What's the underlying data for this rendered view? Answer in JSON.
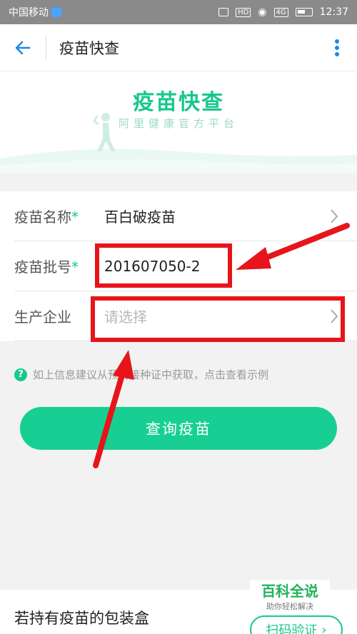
{
  "status_bar": {
    "carrier": "中国移动",
    "network": "4G",
    "hd": "HD",
    "time": "12:37"
  },
  "app_bar": {
    "title": "疫苗快查",
    "back_icon": "back-arrow-icon",
    "more_icon": "more-vertical-icon",
    "accent_color": "#1e88e5"
  },
  "hero": {
    "title": "疫苗快查",
    "subtitle": "阿里健康官方平台",
    "brand_color": "#16c88a"
  },
  "form": {
    "rows": [
      {
        "label": "疫苗名称",
        "required_mark": "*",
        "value": "百白破疫苗",
        "placeholder": ""
      },
      {
        "label": "疫苗批号",
        "required_mark": "*",
        "value": "201607050-2",
        "placeholder": ""
      },
      {
        "label": "生产企业",
        "required_mark": "",
        "value": "",
        "placeholder": "请选择"
      }
    ]
  },
  "hint": {
    "icon": "question-mark-icon",
    "text": "如上信息建议从预防接种证中获取，点击查看示例"
  },
  "query_button": {
    "label": "查询疫苗"
  },
  "bottom_card": {
    "text": "若持有疫苗的包装盒",
    "scan_label": "扫码验证"
  },
  "watermark": {
    "title": "百科全说",
    "subtitle": "助你轻松解决"
  },
  "annotation_color": "#e8141b"
}
